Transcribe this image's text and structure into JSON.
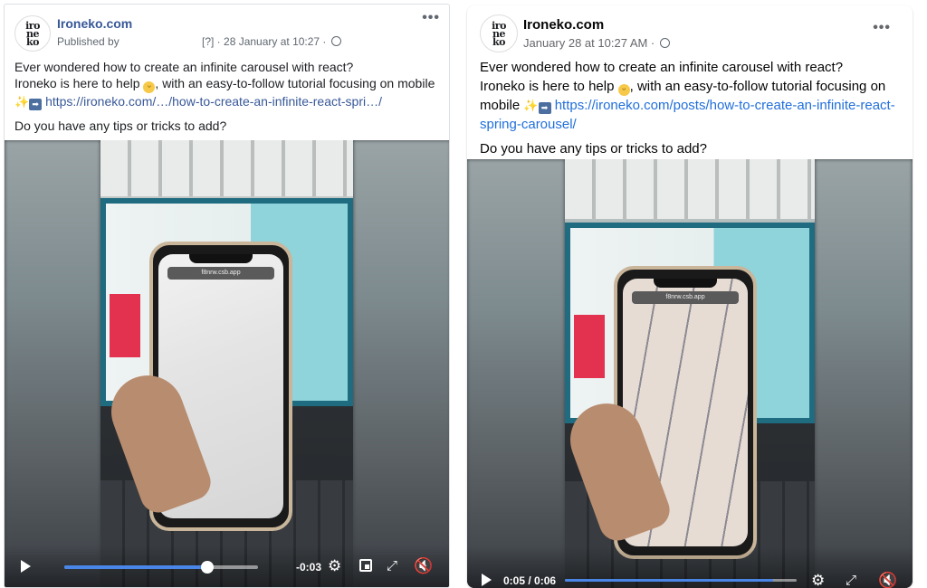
{
  "left_post": {
    "avatar_lines": [
      "iro",
      "ne",
      "ko"
    ],
    "page_name": "Ironeko.com",
    "published_by": "Published by",
    "date_prefix": "[?] · ",
    "date": "28 January at 10:27 ·",
    "more": "•••",
    "line1": "Ever wondered how to create an infinite carousel with react?",
    "line2_a": "Ironeko is here to help",
    "line2_b": ", with an easy-to-follow tutorial focusing on mobile",
    "link": "https://ironeko.com/…/how-to-create-an-infinite-react-spri…/",
    "question": "Do you have any tips or tricks to add?",
    "video": {
      "time_remaining": "-0:03",
      "progress": 0.74,
      "phone_url": "f8nrw.csb.app"
    }
  },
  "right_post": {
    "avatar_lines": [
      "iro",
      "ne",
      "ko"
    ],
    "page_name": "Ironeko.com",
    "date": "January 28 at 10:27 AM ·",
    "more": "•••",
    "line1": "Ever wondered how to create an infinite carousel with react?",
    "line2_a": "Ironeko is here to help",
    "line2_b": ", with an easy-to-follow tutorial focusing on mobile",
    "link": "https://ironeko.com/posts/how-to-create-an-infinite-react-spring-carousel/",
    "question": "Do you have any tips or tricks to add?",
    "video": {
      "time": "0:05 / 0:06",
      "progress": 0.9,
      "phone_url": "f8nrw.csb.app"
    }
  },
  "icons": {
    "emoji": "grinning-face-emoji",
    "sparkles": "sparkles-emoji",
    "arrow": "right-arrow-emoji",
    "settings": "gear-icon",
    "fullscreen": "fullscreen-icon",
    "volume": "muted-volume-icon"
  },
  "colors": {
    "link": "#385898",
    "progress": "#4a86e8"
  }
}
